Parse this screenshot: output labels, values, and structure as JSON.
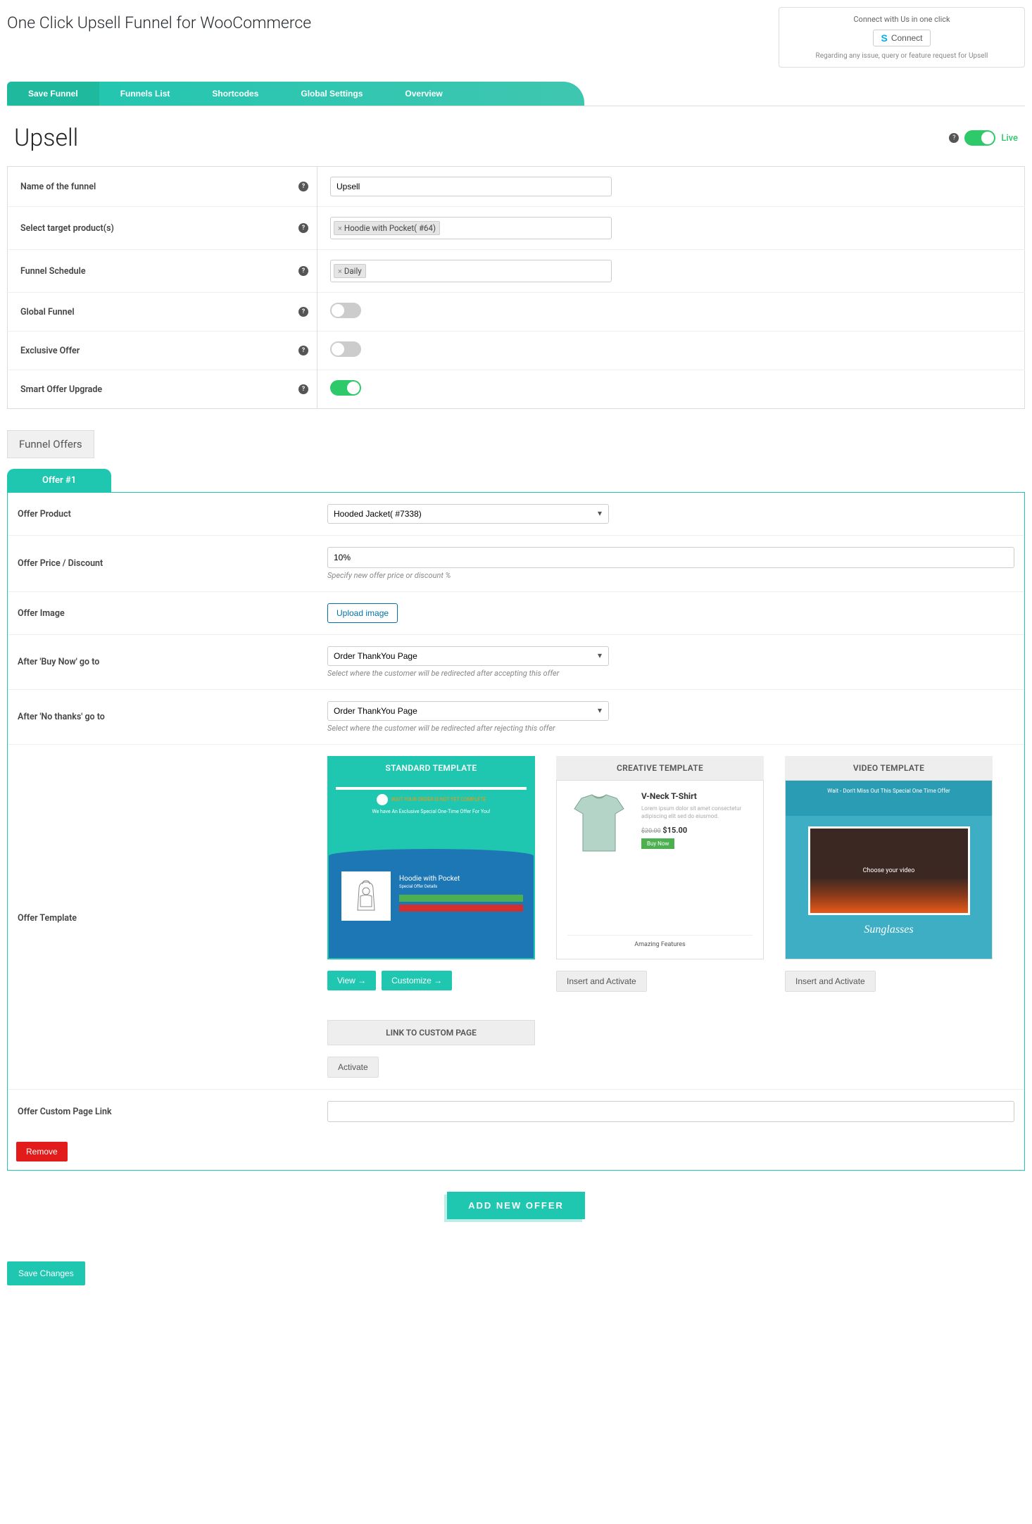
{
  "pageTitle": "One Click Upsell Funnel for WooCommerce",
  "connect": {
    "text": "Connect with Us in one click",
    "button": "Connect",
    "sub": "Regarding any issue, query or feature request for Upsell"
  },
  "tabs": [
    "Save Funnel",
    "Funnels List",
    "Shortcodes",
    "Global Settings",
    "Overview"
  ],
  "funnel": {
    "title": "Upsell",
    "liveLabel": "Live",
    "liveOn": true
  },
  "labels": {
    "name": "Name of the funnel",
    "target": "Select target product(s)",
    "schedule": "Funnel Schedule",
    "global": "Global Funnel",
    "exclusive": "Exclusive Offer",
    "smart": "Smart Offer Upgrade"
  },
  "values": {
    "name": "Upsell",
    "targetTag": "Hoodie with Pocket( #64)",
    "scheduleTag": "Daily",
    "globalOn": false,
    "exclusiveOn": false,
    "smartOn": true
  },
  "offersHeader": "Funnel Offers",
  "offerTab": "Offer #1",
  "offerLabels": {
    "product": "Offer Product",
    "price": "Offer Price / Discount",
    "priceHelp": "Specify new offer price or discount %",
    "image": "Offer Image",
    "upload": "Upload image",
    "buyNow": "After 'Buy Now' go to",
    "buyNowHelp": "Select where the customer will be redirected after accepting this offer",
    "noThanks": "After 'No thanks' go to",
    "noThanksHelp": "Select where the customer will be redirected after rejecting this offer",
    "template": "Offer Template",
    "customLink": "Offer Custom Page Link"
  },
  "offerValues": {
    "product": "Hooded Jacket( #7338)",
    "price": "10%",
    "buyNow": "Order ThankYou Page",
    "noThanks": "Order ThankYou Page",
    "customLink": ""
  },
  "templates": {
    "standard": {
      "header": "STANDARD TEMPLATE",
      "view": "View →",
      "customize": "Customize →",
      "prodName": "Hoodie with Pocket"
    },
    "creative": {
      "header": "CREATIVE TEMPLATE",
      "action": "Insert and Activate",
      "prodName": "V-Neck T-Shirt",
      "price": "$15.00",
      "footer": "Amazing Features"
    },
    "video": {
      "header": "VIDEO TEMPLATE",
      "action": "Insert and Activate",
      "topText": "Wait - Don't Miss Out This Special One Time Offer",
      "vidText": "Choose your video",
      "prodName": "Sunglasses"
    },
    "custom": {
      "header": "LINK TO CUSTOM PAGE",
      "action": "Activate"
    }
  },
  "buttons": {
    "remove": "Remove",
    "addOffer": "ADD NEW OFFER",
    "save": "Save Changes"
  }
}
